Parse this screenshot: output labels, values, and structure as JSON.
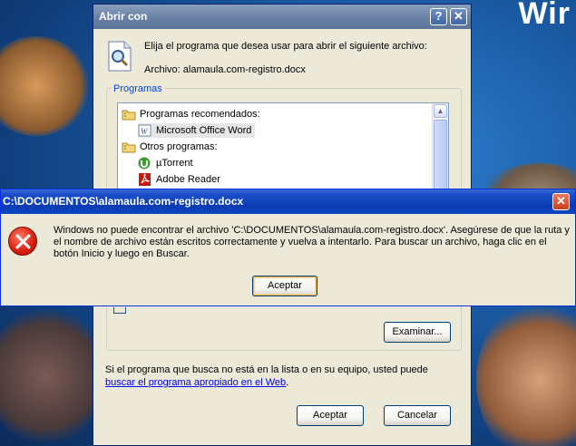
{
  "desktop": {
    "wordmark": "Wir"
  },
  "open_with": {
    "title": "Abrir con",
    "help_button": "?",
    "close_button": "✕",
    "prompt": "Elija el programa que desea usar para abrir el siguiente archivo:",
    "file_line": "Archivo: alamaula.com-registro.docx",
    "group_label": "Programas",
    "list": [
      {
        "label": "Programas recomendados:",
        "icon": "folder-icon",
        "kind": "header"
      },
      {
        "label": "Microsoft Office Word",
        "icon": "word-icon",
        "kind": "item",
        "selected": true
      },
      {
        "label": "Otros programas:",
        "icon": "folder-icon",
        "kind": "header"
      },
      {
        "label": "µTorrent",
        "icon": "utorrent-icon",
        "kind": "item"
      },
      {
        "label": "Adobe Reader",
        "icon": "adobe-reader-icon",
        "kind": "item"
      }
    ],
    "browse_button": "Examinar...",
    "hint_text": "Si el programa que busca no está en la lista o en su equipo, usted puede ",
    "hint_link": "buscar el programa apropiado en el Web",
    "hint_end": ".",
    "accept_button": "Aceptar",
    "cancel_button": "Cancelar"
  },
  "error_dialog": {
    "title": "C:\\DOCUMENTOS\\alamaula.com-registro.docx",
    "close_button": "✕",
    "message": "Windows no puede encontrar el archivo 'C:\\DOCUMENTOS\\alamaula.com-registro.docx'. Asegúrese de que la ruta y el nombre de archivo están escritos correctamente y vuelva a intentarlo. Para buscar un archivo, haga clic en el botón Inicio y luego en Buscar.",
    "ok_button": "Aceptar",
    "icon": "error-icon"
  },
  "colors": {
    "link": "#0000ee",
    "group_label": "#0046d5",
    "error_title_bar": "#0a3bb3"
  }
}
